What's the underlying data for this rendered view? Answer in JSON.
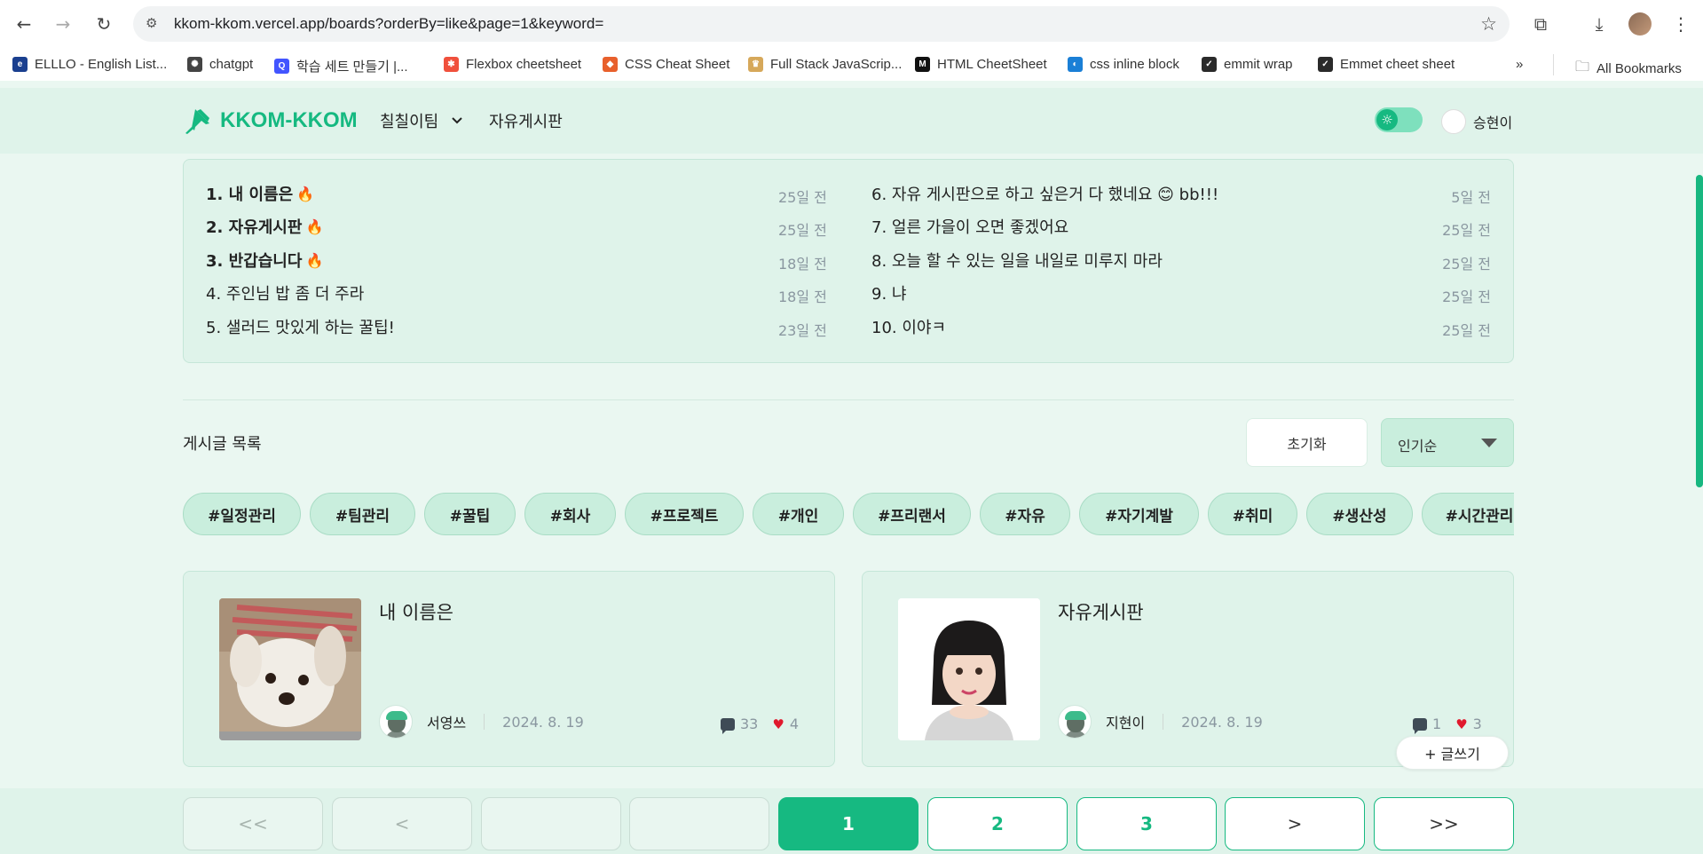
{
  "browser": {
    "url": "kkom-kkom.vercel.app/boards?orderBy=like&page=1&keyword=",
    "bookmarks": [
      {
        "label": "ELLLO - English List...",
        "color": "#1a3f8f",
        "glyph": "e"
      },
      {
        "label": "chatgpt",
        "color": "#444444",
        "glyph": "✺"
      },
      {
        "label": "학습 세트 만들기 |...",
        "color": "#4255ff",
        "glyph": "Q"
      },
      {
        "label": "Flexbox cheetsheet",
        "color": "#f0503c",
        "glyph": "✱"
      },
      {
        "label": "CSS Cheat Sheet",
        "color": "#e8602c",
        "glyph": "◆"
      },
      {
        "label": "Full Stack JavaScrip...",
        "color": "#d6a85a",
        "glyph": "♛"
      },
      {
        "label": "HTML CheetSheet",
        "color": "#111111",
        "glyph": "M"
      },
      {
        "label": "css inline block",
        "color": "#1a7fd6",
        "glyph": "◐"
      },
      {
        "label": "emmit wrap",
        "color": "#2a2a2a",
        "glyph": "✓"
      },
      {
        "label": "Emmet cheet sheet",
        "color": "#2a2a2a",
        "glyph": "✓"
      }
    ],
    "all_bookmarks": "All Bookmarks"
  },
  "header": {
    "logo": "KKOM-KKOM",
    "team": "칠칠이팀",
    "board_link": "자유게시판",
    "user": "승현이"
  },
  "ranking": {
    "left": [
      {
        "text": "1. 내 이름은",
        "hot": true,
        "date": "25일 전"
      },
      {
        "text": "2. 자유게시판",
        "hot": true,
        "date": "25일 전"
      },
      {
        "text": "3. 반갑습니다",
        "hot": true,
        "date": "18일 전"
      },
      {
        "text": "4. 주인님 밥 좀 더 주라",
        "hot": false,
        "date": "18일 전"
      },
      {
        "text": "5. 샐러드 맛있게 하는 꿀팁!",
        "hot": false,
        "date": "23일 전"
      }
    ],
    "right": [
      {
        "text": "6. 자유 게시판으로 하고 싶은거 다 했네요 😊 bb!!!",
        "date": "5일 전"
      },
      {
        "text": "7. 얼른 가을이 오면 좋겠어요",
        "date": "25일 전"
      },
      {
        "text": "8. 오늘 할 수 있는 일을 내일로 미루지 마라",
        "date": "25일 전"
      },
      {
        "text": "9. 냐",
        "date": "25일 전"
      },
      {
        "text": "10. 이야ㅋ",
        "date": "25일 전"
      }
    ]
  },
  "list": {
    "title": "게시글 목록",
    "reset": "초기화",
    "sort": "인기순"
  },
  "tags": [
    "#일정관리",
    "#팀관리",
    "#꿀팁",
    "#회사",
    "#프로젝트",
    "#개인",
    "#프리랜서",
    "#자유",
    "#자기계발",
    "#취미",
    "#생산성",
    "#시간관리"
  ],
  "cards": [
    {
      "title": "내 이름은",
      "author": "서영쓰",
      "date": "2024. 8. 19",
      "comments": "33",
      "likes": "4"
    },
    {
      "title": "자유게시판",
      "author": "지현이",
      "date": "2024. 8. 19",
      "comments": "1",
      "likes": "3"
    }
  ],
  "write_button": "+ 글쓰기",
  "pagination": {
    "first": "<<",
    "prev": "<",
    "pages": [
      "1",
      "2",
      "3"
    ],
    "current_page": 1,
    "next": ">",
    "last": ">>"
  },
  "colors": {
    "accent": "#16b981",
    "background": "#eaf7f1",
    "panel": "#dff3ea",
    "heart": "#e0192d"
  }
}
